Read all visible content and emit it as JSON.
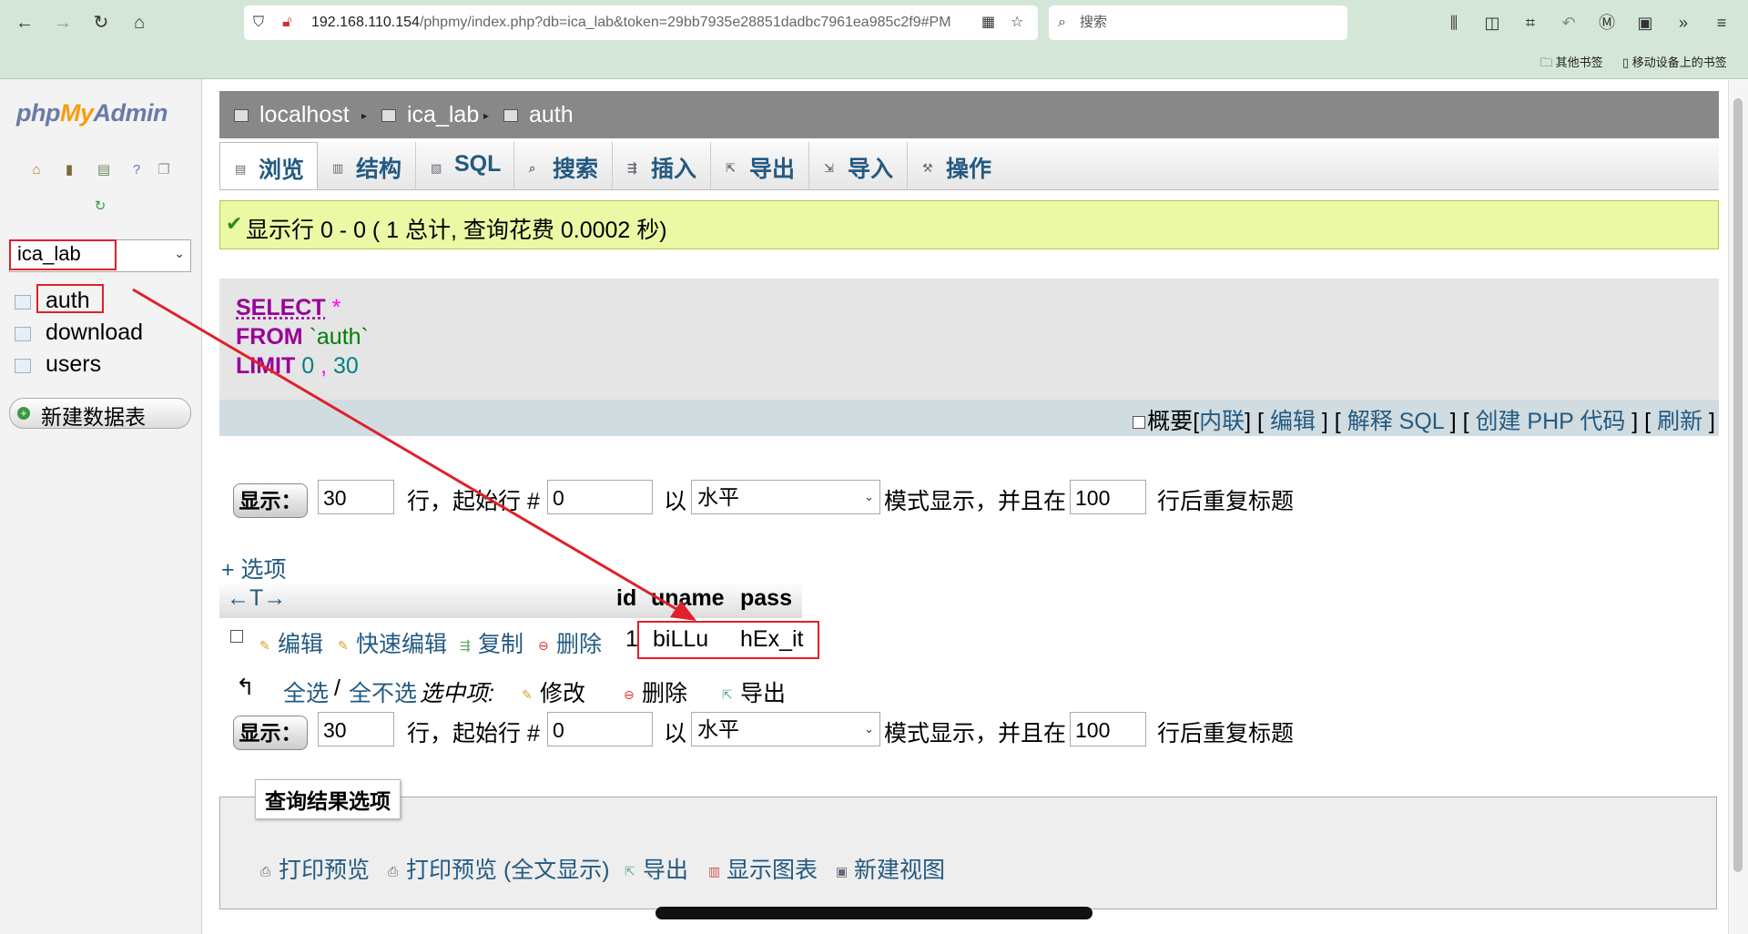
{
  "browser": {
    "url_host": "192.168.110.154",
    "url_path": "/phpmy/index.php?db=ica_lab&token=29bb7935e28851dadbc7961ea985c2f9#PM",
    "search_placeholder": "搜索",
    "bookmarks": [
      "其他书签",
      "移动设备上的书签"
    ]
  },
  "sidebar": {
    "logo": {
      "php": "php",
      "my": "My",
      "admin": "Admin"
    },
    "db_selected": "ica_lab",
    "tables": [
      "auth",
      "download",
      "users"
    ],
    "new_table": "新建数据表"
  },
  "breadcrumb": {
    "server": "localhost",
    "database": "ica_lab",
    "table": "auth"
  },
  "tabs": [
    "浏览",
    "结构",
    "SQL",
    "搜索",
    "插入",
    "导出",
    "导入",
    "操作"
  ],
  "success_message": "显示行 0 - 0 ( 1 总计, 查询花费 0.0002 秒)",
  "sql": {
    "select": "SELECT",
    "star": "*",
    "from": "FROM",
    "table": "`auth`",
    "limit": "LIMIT",
    "offset": "0",
    "comma": ",",
    "count": "30"
  },
  "sql_actions": {
    "profiling": "概要",
    "inline": "内联",
    "edit": "编辑",
    "explain": "解释 SQL",
    "php_code": "创建 PHP 代码",
    "refresh": "刷新"
  },
  "nav": {
    "show_btn": "显示：",
    "rows": "30",
    "rows_label": "行，起始行 #",
    "start": "0",
    "in_label": "以",
    "mode": "水平",
    "mode_label": "模式显示，并且在",
    "repeat": "100",
    "repeat_label": "行后重复标题"
  },
  "options_link": "+ 选项",
  "results": {
    "sort_arrows": "←T→",
    "columns": [
      "id",
      "uname",
      "pass"
    ],
    "row_actions": {
      "edit": "编辑",
      "quick_edit": "快速编辑",
      "copy": "复制",
      "delete": "删除"
    },
    "row": {
      "id": "1",
      "uname": "biLLu",
      "pass": "hEx_it"
    }
  },
  "bulk": {
    "check_all": "全选",
    "sep": "/",
    "uncheck_all": "全不选",
    "with_selected": "选中项:",
    "change": "修改",
    "delete": "删除",
    "export": "导出"
  },
  "query_results_options": {
    "legend": "查询结果选项",
    "print_view": "打印预览",
    "print_view_full": "打印预览 (全文显示)",
    "export": "导出",
    "display_chart": "显示图表",
    "create_view": "新建视图"
  },
  "colors": {
    "accent_link": "#235a81",
    "annotation_red": "#e0202a",
    "success_bg": "#ebf8a4"
  }
}
